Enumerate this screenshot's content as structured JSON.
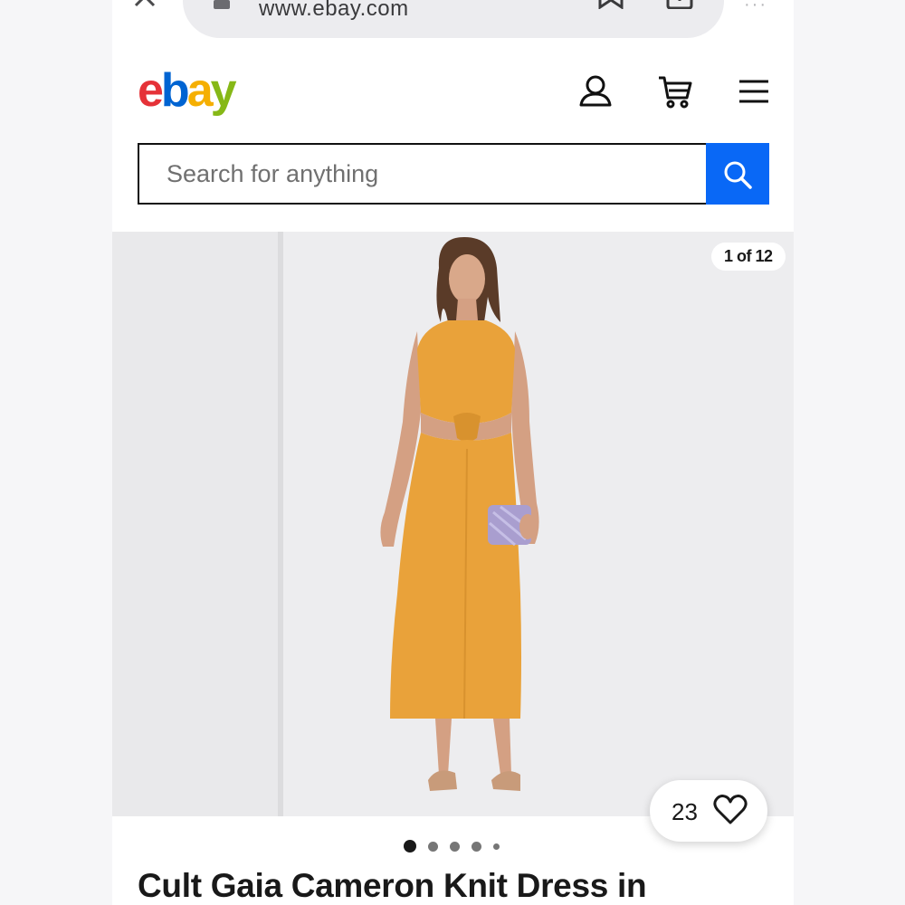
{
  "browser": {
    "url": "www.ebay.com"
  },
  "header": {
    "logo": [
      "e",
      "b",
      "a",
      "y"
    ],
    "icons": [
      "user-icon",
      "cart-icon",
      "menu-icon"
    ]
  },
  "search": {
    "placeholder": "Search for anything",
    "button_icon": "search-icon"
  },
  "gallery": {
    "counter": "1 of 12",
    "image_position": 1,
    "image_total": 12,
    "favorites_count": "23",
    "dot_count": 5,
    "active_dot": 0
  },
  "listing": {
    "title": "Cult Gaia Cameron Knit Dress in"
  },
  "colors": {
    "ebay_red": "#e53238",
    "ebay_blue": "#0064d2",
    "ebay_yellow": "#f5af02",
    "ebay_green": "#86b817",
    "search_button": "#0968f6",
    "dress": "#e9a23a"
  }
}
